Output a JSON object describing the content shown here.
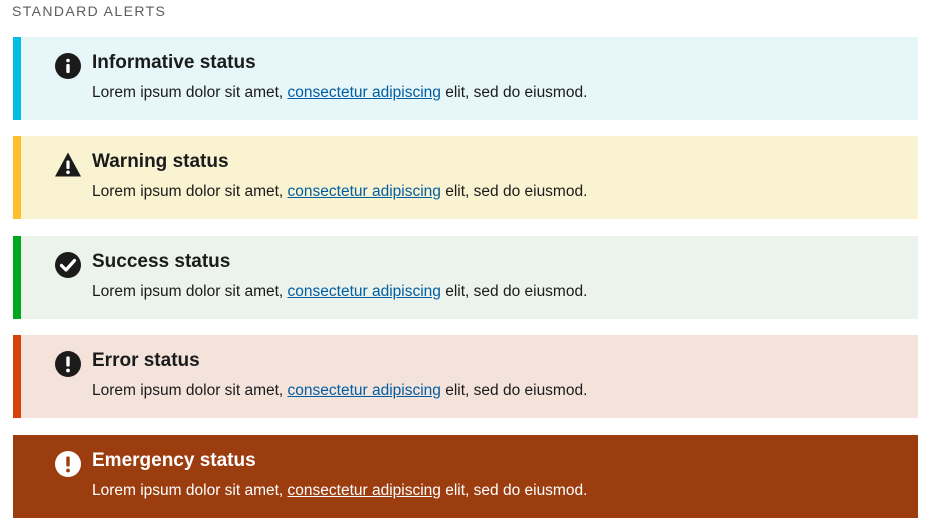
{
  "section_label": "STANDARD ALERTS",
  "alerts": [
    {
      "title": "Informative status",
      "text_before": "Lorem ipsum dolor sit amet, ",
      "link": "consectetur adipiscing",
      "text_after": " elit, sed do eiusmod.",
      "icon": "info-icon",
      "bg": "#e7f6f8",
      "accent": "#00bde3"
    },
    {
      "title": "Warning status",
      "text_before": "Lorem ipsum dolor sit amet, ",
      "link": "consectetur adipiscing",
      "text_after": " elit, sed do eiusmod.",
      "icon": "warning-icon",
      "bg": "#faf3d1",
      "accent": "#ffbe2e"
    },
    {
      "title": "Success status",
      "text_before": "Lorem ipsum dolor sit amet, ",
      "link": "consectetur adipiscing",
      "text_after": " elit, sed do eiusmod.",
      "icon": "check-circle-icon",
      "bg": "#ecf3ec",
      "accent": "#00a91c"
    },
    {
      "title": "Error status",
      "text_before": "Lorem ipsum dolor sit amet, ",
      "link": "consectetur adipiscing",
      "text_after": " elit, sed do eiusmod.",
      "icon": "error-icon",
      "bg": "#f4e3db",
      "accent": "#d54309"
    },
    {
      "title": "Emergency status",
      "text_before": "Lorem ipsum dolor sit amet, ",
      "link": "consectetur adipiscing",
      "text_after": " elit, sed do eiusmod.",
      "icon": "emergency-icon",
      "bg": "#9c3d10",
      "accent": "#9c3d10"
    }
  ]
}
